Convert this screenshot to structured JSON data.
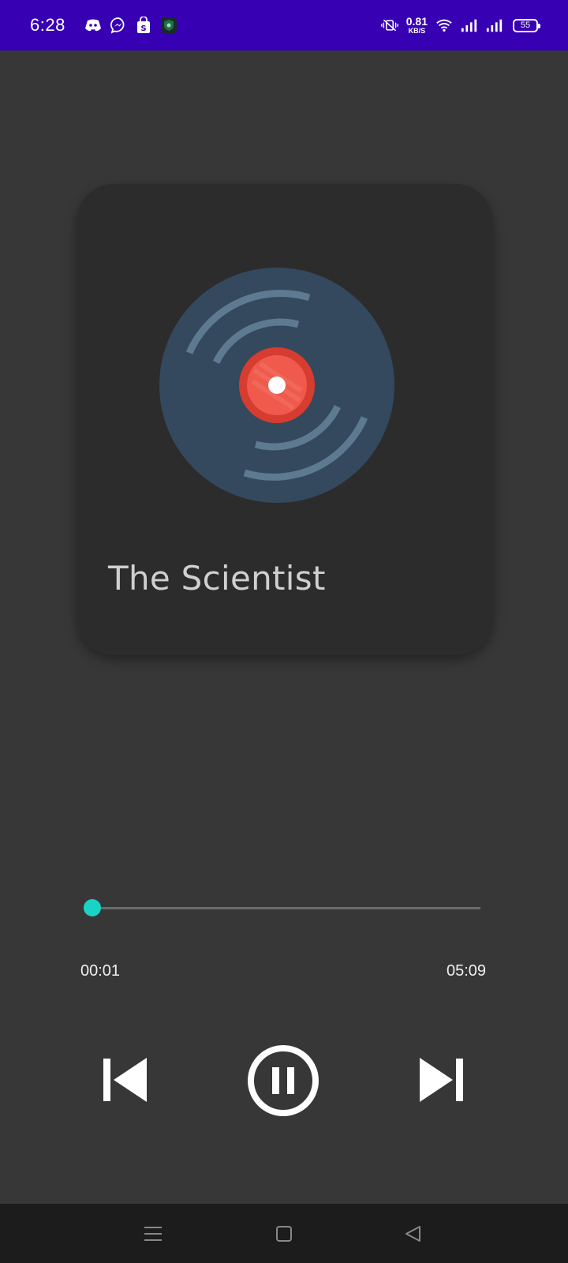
{
  "status_bar": {
    "time": "6:28",
    "net_speed_value": "0.81",
    "net_speed_unit": "KB/S",
    "battery_level": "55",
    "notification_icons": [
      "discord-icon",
      "messenger-icon",
      "shopping-bag-icon",
      "shield-app-icon"
    ],
    "system_icons": [
      "vibrate-mute-icon",
      "wifi-icon",
      "signal-1-icon",
      "signal-2-icon",
      "battery-icon"
    ],
    "background_color": "#3700b3"
  },
  "player": {
    "song_title": "The Scientist",
    "current_time": "00:01",
    "total_time": "05:09",
    "progress_fraction": 0.003,
    "accent_color": "#19d3c5",
    "controls": {
      "previous": "skip-previous-icon",
      "play_pause": "pause-circle-icon",
      "next": "skip-next-icon"
    }
  },
  "album_art": {
    "icon": "vinyl-record-icon",
    "disc_color": "#34495e",
    "label_color": "#e74c3c"
  },
  "nav_bar": {
    "buttons": [
      "menu-icon",
      "home-icon",
      "back-icon"
    ]
  }
}
